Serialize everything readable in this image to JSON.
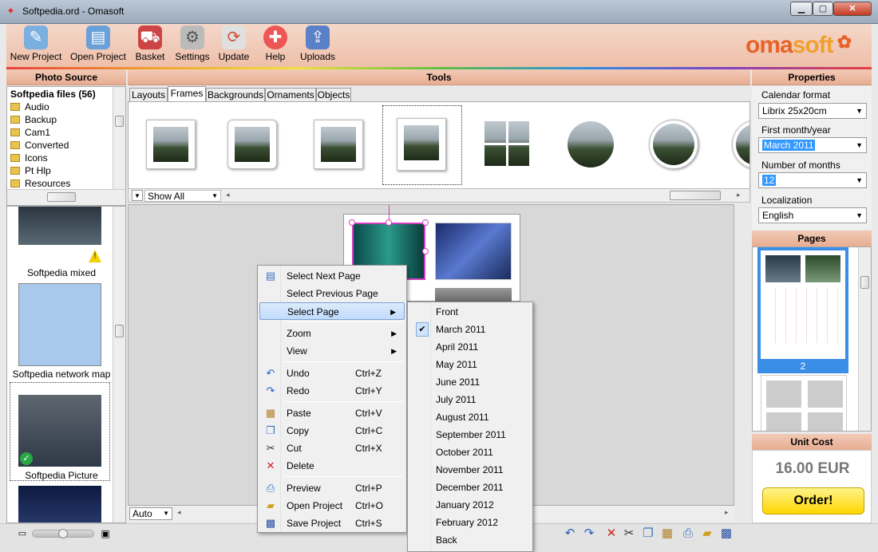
{
  "window": {
    "title": "Softpedia.ord - Omasoft"
  },
  "toolbar": {
    "buttons": [
      {
        "label": "New Project",
        "icon": "new-project-icon"
      },
      {
        "label": "Open Project",
        "icon": "open-project-icon"
      },
      {
        "label": "Basket",
        "icon": "basket-icon"
      },
      {
        "label": "Settings",
        "icon": "settings-icon"
      },
      {
        "label": "Update",
        "icon": "update-icon"
      },
      {
        "label": "Help",
        "icon": "help-icon"
      },
      {
        "label": "Uploads",
        "icon": "uploads-icon"
      }
    ],
    "logo_part1": "oma",
    "logo_part2": "soft"
  },
  "sections": {
    "photo_source": "Photo Source",
    "tools": "Tools",
    "properties": "Properties",
    "pages": "Pages",
    "unit_cost": "Unit Cost"
  },
  "tree": {
    "root": "Softpedia files (56)",
    "items": [
      "Audio",
      "Backup",
      "Cam1",
      "Converted",
      "Icons",
      "Pt Hlp",
      "Resources"
    ]
  },
  "photos": [
    "Softpedia mixed",
    "Softpedia network map",
    "Softpedia Picture"
  ],
  "tabs": [
    "Layouts",
    "Frames",
    "Backgrounds",
    "Ornaments",
    "Objects"
  ],
  "filter": {
    "value": "Show All"
  },
  "zoom": {
    "value": "Auto"
  },
  "context_menu": {
    "items": [
      {
        "label": "Select Next Page",
        "shortcut": ""
      },
      {
        "label": "Select Previous Page",
        "shortcut": ""
      },
      {
        "label": "Select Page",
        "shortcut": ""
      },
      {
        "label": "Zoom",
        "shortcut": ""
      },
      {
        "label": "View",
        "shortcut": ""
      },
      {
        "label": "Undo",
        "shortcut": "Ctrl+Z"
      },
      {
        "label": "Redo",
        "shortcut": "Ctrl+Y"
      },
      {
        "label": "Paste",
        "shortcut": "Ctrl+V"
      },
      {
        "label": "Copy",
        "shortcut": "Ctrl+C"
      },
      {
        "label": "Cut",
        "shortcut": "Ctrl+X"
      },
      {
        "label": "Delete",
        "shortcut": ""
      },
      {
        "label": "Preview",
        "shortcut": "Ctrl+P"
      },
      {
        "label": "Open Project",
        "shortcut": "Ctrl+O"
      },
      {
        "label": "Save Project",
        "shortcut": "Ctrl+S"
      }
    ]
  },
  "submenu": {
    "items": [
      "Front",
      "March 2011",
      "April 2011",
      "May 2011",
      "June 2011",
      "July 2011",
      "August 2011",
      "September 2011",
      "October 2011",
      "November 2011",
      "December 2011",
      "January 2012",
      "February 2012",
      "Back"
    ],
    "checked": "March 2011"
  },
  "properties": {
    "calendar_format_label": "Calendar format",
    "calendar_format_value": "Librix 25x20cm",
    "first_month_label": "First month/year",
    "first_month_value": "March 2011",
    "months_label": "Number of months",
    "months_value": "12",
    "localization_label": "Localization",
    "localization_value": "English"
  },
  "pages": {
    "selected_number": "2"
  },
  "unit_cost": {
    "price": "16.00 EUR",
    "order_label": "Order!"
  }
}
